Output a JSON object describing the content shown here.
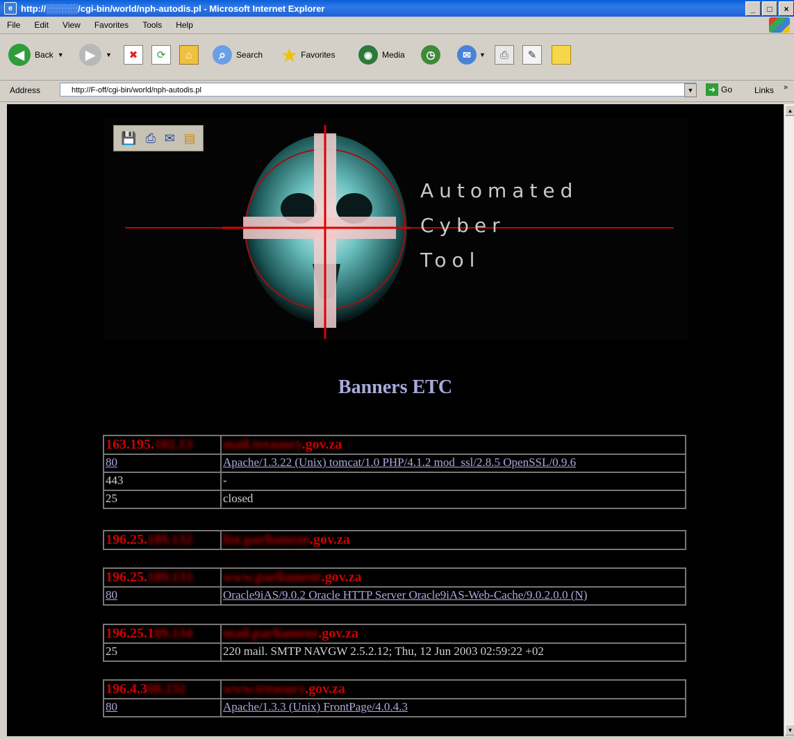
{
  "window": {
    "title": "http://░░░░░/cgi-bin/world/nph-autodis.pl - Microsoft Internet Explorer",
    "title_icon": "ie-icon"
  },
  "menu": [
    "File",
    "Edit",
    "View",
    "Favorites",
    "Tools",
    "Help"
  ],
  "toolbar": {
    "back": "Back",
    "search": "Search",
    "favorites": "Favorites",
    "media": "Media"
  },
  "address": {
    "label": "Address",
    "value": "http://F-off/cgi-bin/world/nph-autodis.pl",
    "go": "Go",
    "links": "Links"
  },
  "banner": {
    "line1": "Automated",
    "line2": "Cyber",
    "line3": "Tool"
  },
  "page": {
    "heading": "Banners ETC"
  },
  "hosts": [
    {
      "ip_visible": "163.195.",
      "ip_redacted": "102.13",
      "host_redacted": "mail.treasury",
      "host_visible": ".gov.za",
      "ports": [
        {
          "port": "80",
          "banner": "Apache/1.3.22 (Unix) tomcat/1.0 PHP/4.1.2 mod_ssl/2.8.5 OpenSSL/0.9.6",
          "link": true
        },
        {
          "port": "443",
          "banner": "-",
          "link": false
        },
        {
          "port": "25",
          "banner": "closed",
          "link": false
        }
      ]
    },
    {
      "ip_visible": "196.25.",
      "ip_redacted": "189.132",
      "host_redacted": "list.parliament",
      "host_visible": ".gov.za",
      "ports": []
    },
    {
      "ip_visible": "196.25.",
      "ip_redacted": "189.133",
      "host_redacted": "www.parliament",
      "host_visible": ".gov.za",
      "ports": [
        {
          "port": "80",
          "banner": "Oracle9iAS/9.0.2 Oracle HTTP Server Oracle9iAS-Web-Cache/9.0.2.0.0 (N)",
          "link": true
        }
      ]
    },
    {
      "ip_visible": "196.25.1",
      "ip_redacted": "89.134",
      "host_redacted": "mail.parliament",
      "host_visible": ".gov.za",
      "ports": [
        {
          "port": "25",
          "banner": "220 mail. SMTP NAVGW 2.5.2.12; Thu, 12 Jun 2003 02:59:22 +02",
          "link": false
        }
      ]
    },
    {
      "ip_visible": "196.4.3",
      "ip_redacted": "08.232",
      "host_redacted": "www.treasury",
      "host_visible": ".gov.za",
      "ports": [
        {
          "port": "80",
          "banner": "Apache/1.3.3 (Unix) FrontPage/4.0.4.3",
          "link": true
        }
      ]
    }
  ]
}
